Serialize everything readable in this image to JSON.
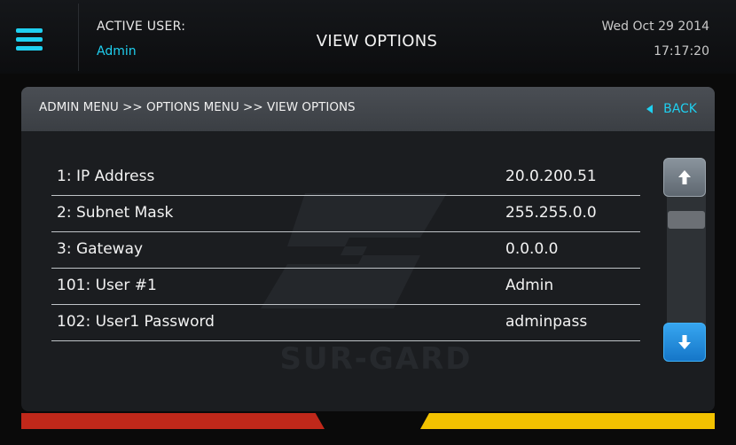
{
  "header": {
    "active_user_label": "ACTIVE USER:",
    "active_user": "Admin",
    "title": "VIEW OPTIONS",
    "date": "Wed Oct 29 2014",
    "time": "17:17:20"
  },
  "breadcrumb": {
    "path": "ADMIN MENU >> OPTIONS MENU >> VIEW OPTIONS",
    "back_label": "BACK"
  },
  "options": [
    {
      "label": "1: IP Address",
      "value": "20.0.200.51"
    },
    {
      "label": "2: Subnet Mask",
      "value": "255.255.0.0"
    },
    {
      "label": "3: Gateway",
      "value": "0.0.0.0"
    },
    {
      "label": "101: User #1",
      "value": "Admin"
    },
    {
      "label": "102: User1 Password",
      "value": "adminpass"
    }
  ],
  "watermark_text": "SUR-GARD",
  "icons": {
    "menu": "hamburger-icon",
    "back": "back-triangle-icon",
    "scroll_up": "arrow-up-icon",
    "scroll_down": "arrow-down-icon"
  },
  "colors": {
    "accent": "#1fd0f0",
    "status_red": "#c0281a",
    "status_yellow": "#f2c200",
    "scroll_down_blue": "#1f8ee0"
  }
}
